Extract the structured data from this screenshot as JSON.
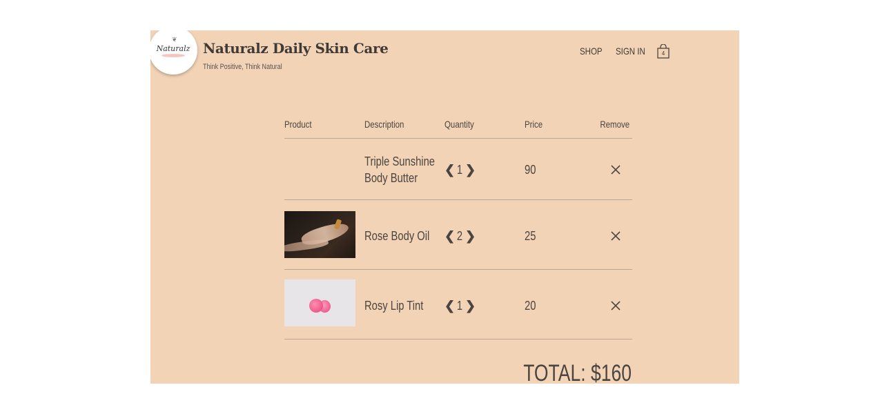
{
  "header": {
    "logo_text": "Naturalz",
    "title": "Naturalz Daily Skin Care",
    "tagline": "Think Positive, Think Natural",
    "nav": {
      "shop": "SHOP",
      "sign_in": "SIGN IN"
    },
    "cart_count": "4"
  },
  "cart": {
    "columns": {
      "product": "Product",
      "description": "Description",
      "quantity": "Quantity",
      "price": "Price",
      "remove": "Remove"
    },
    "items": [
      {
        "description_line1": "Triple Sunshine",
        "description_line2": "Body Butter",
        "quantity": "1",
        "price": "90",
        "image": "none"
      },
      {
        "description_line1": "Rose Body Oil",
        "quantity": "2",
        "price": "25",
        "image": "hands-applying-oil-photo"
      },
      {
        "description_line1": "Rosy Lip Tint",
        "quantity": "1",
        "price": "20",
        "image": "pink-lip-tint-tins-photo"
      }
    ],
    "total": "TOTAL: $160"
  },
  "icons": {
    "decrement": "❮",
    "increment": "❯",
    "remove": "close-icon",
    "cart": "shopping-bag-icon"
  },
  "colors": {
    "page_background": "#f2d3b6",
    "text": "#4a4540"
  }
}
